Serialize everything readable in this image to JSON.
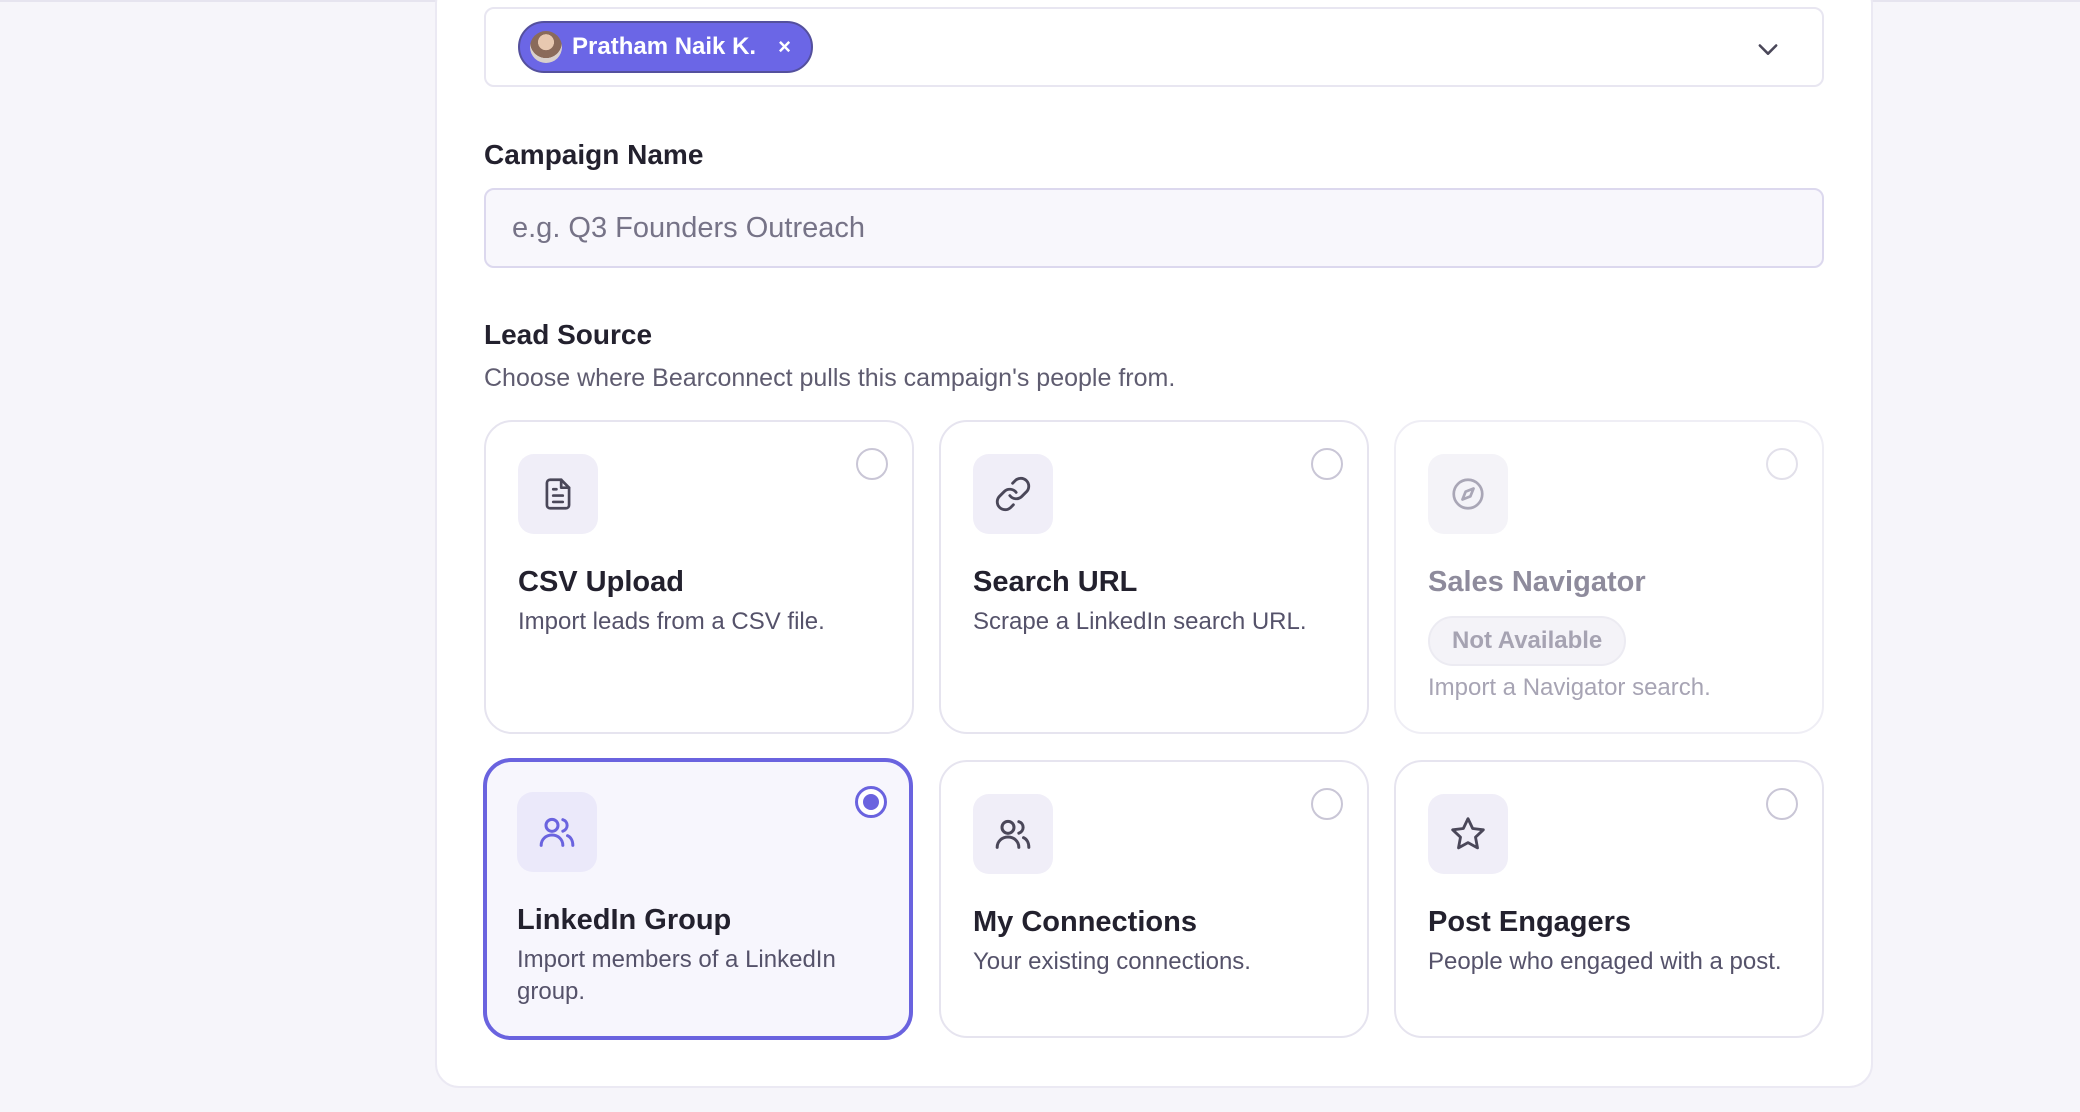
{
  "assignee": {
    "chip_label": "Pratham Naik K.",
    "remove_glyph": "×"
  },
  "campaign": {
    "label": "Campaign Name",
    "placeholder": "e.g. Q3 Founders Outreach"
  },
  "lead_source": {
    "label": "Lead Source",
    "help": "Choose where Bearconnect pulls this campaign's people from.",
    "not_available_label": "Not Available",
    "options": [
      {
        "title": "CSV Upload",
        "desc": "Import leads from a CSV file.",
        "icon": "document-icon",
        "selected": false,
        "disabled": false
      },
      {
        "title": "Search URL",
        "desc": "Scrape a LinkedIn search URL.",
        "icon": "link-icon",
        "selected": false,
        "disabled": false
      },
      {
        "title": "Sales Navigator",
        "desc": "Import a Navigator search.",
        "icon": "compass-icon",
        "selected": false,
        "disabled": true
      },
      {
        "title": "LinkedIn Group",
        "desc": "Import members of a LinkedIn group.",
        "icon": "users-icon",
        "selected": true,
        "disabled": false
      },
      {
        "title": "My Connections",
        "desc": "Your existing connections.",
        "icon": "users-icon",
        "selected": false,
        "disabled": false
      },
      {
        "title": "Post Engagers",
        "desc": "People who engaged with a post.",
        "icon": "star-icon",
        "selected": false,
        "disabled": false
      }
    ]
  },
  "colors": {
    "accent": "#6a63df",
    "chip_bg": "#6b66e6",
    "text": "#23212e",
    "muted": "#5f5c70"
  }
}
